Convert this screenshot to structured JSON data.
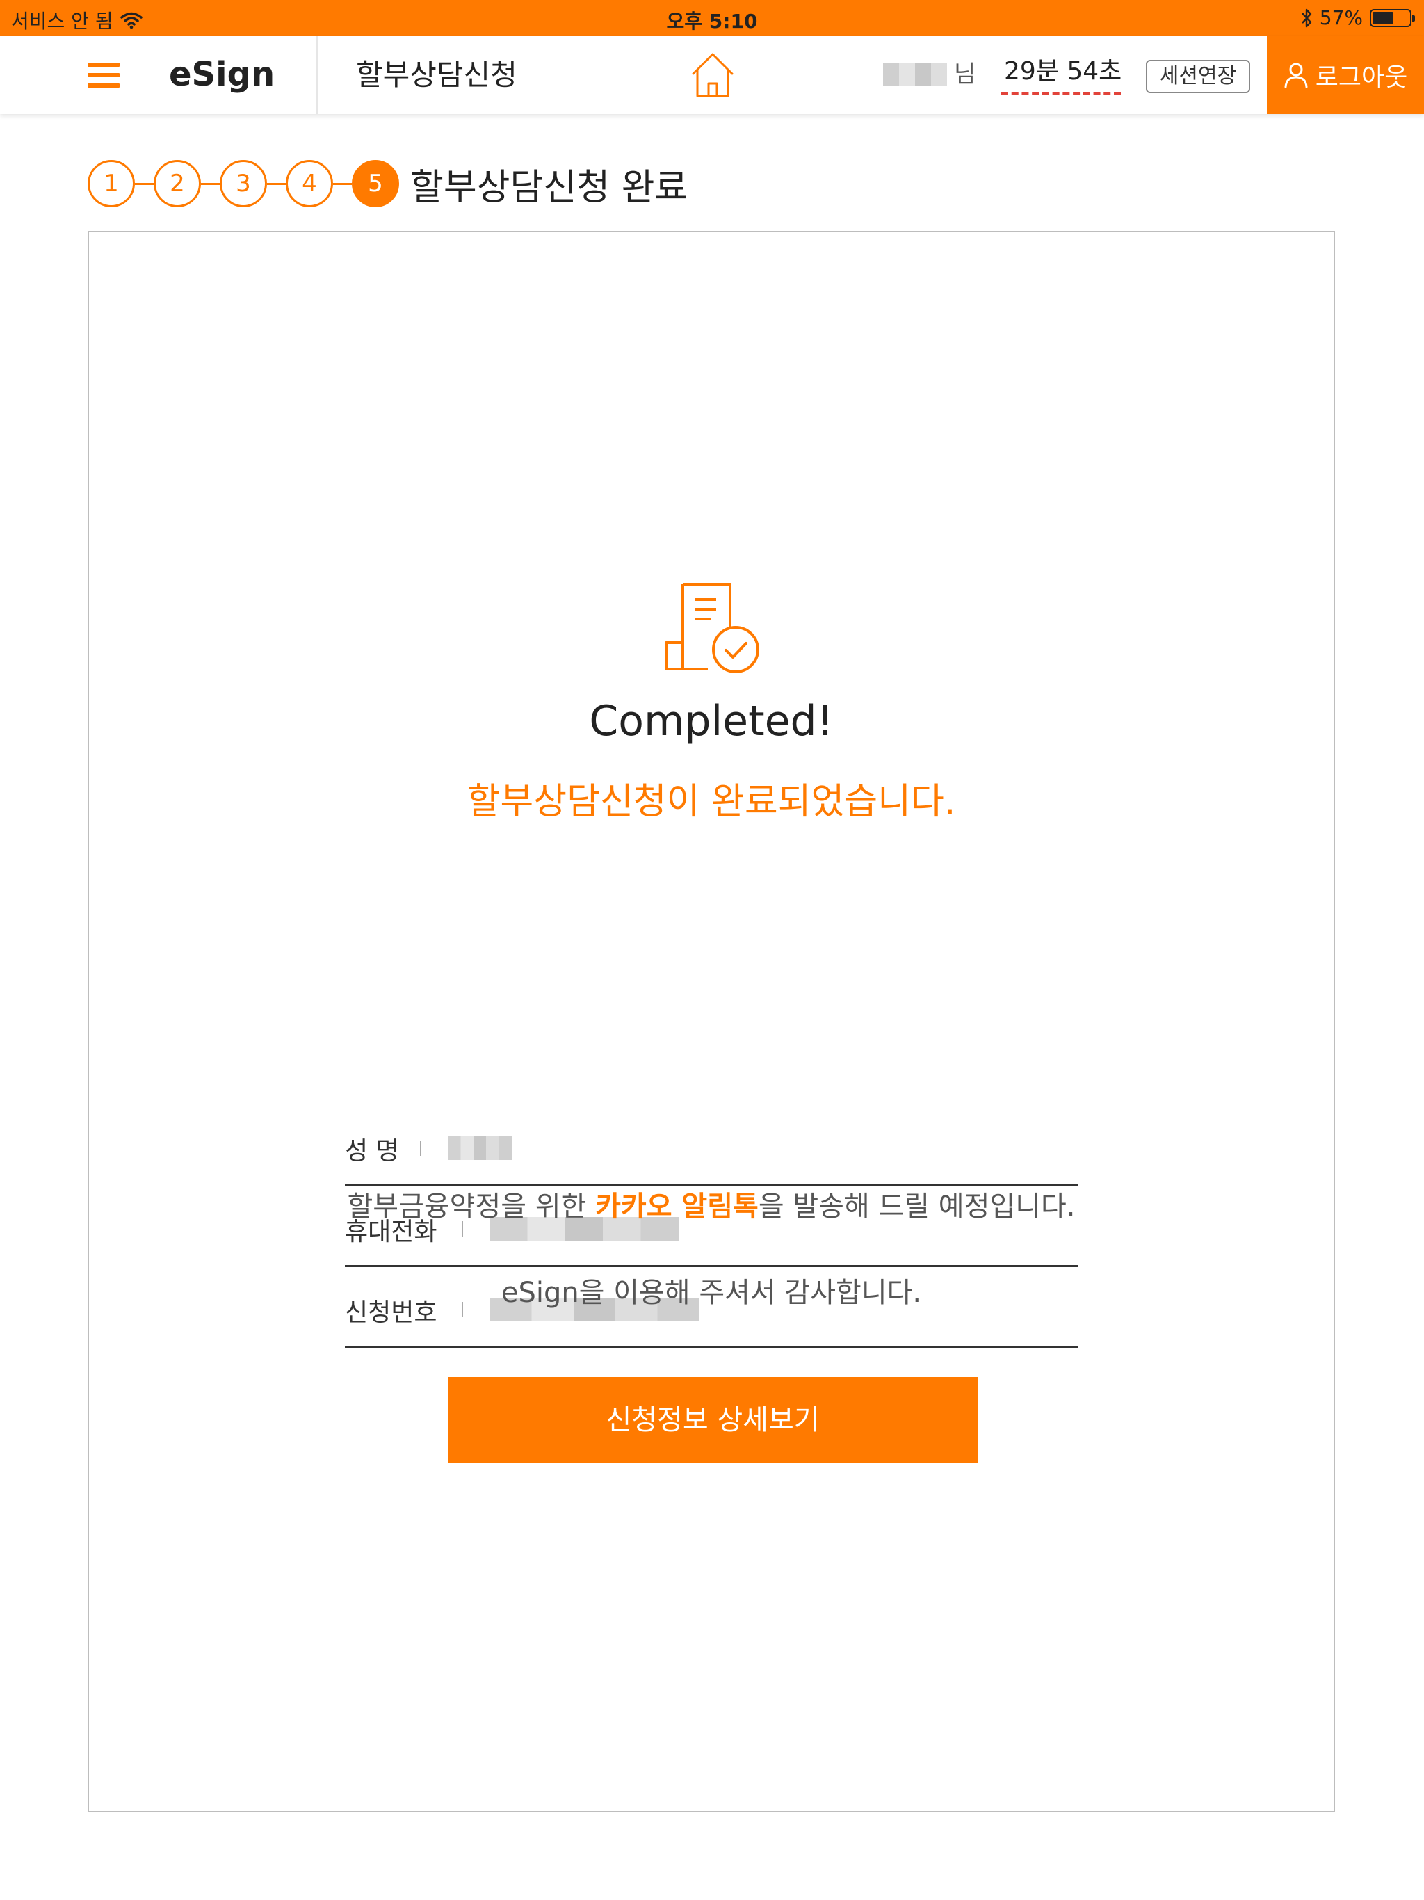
{
  "status_bar": {
    "carrier": "서비스 안 됨",
    "time": "오후 5:10",
    "battery_text": "57%",
    "battery_level": 0.57,
    "icons": [
      "wifi-icon",
      "bluetooth-icon",
      "battery-icon"
    ]
  },
  "header": {
    "brand": "eSign",
    "title": "할부상담신청",
    "user_suffix": "님",
    "timer": "29분 54초",
    "session_extend_label": "세션연장",
    "logout_label": "로그아웃",
    "icons": [
      "menu-icon",
      "home-icon",
      "user-icon"
    ]
  },
  "steps": {
    "items": [
      "1",
      "2",
      "3",
      "4",
      "5"
    ],
    "active_index": 4,
    "title": "할부상담신청 완료"
  },
  "result": {
    "icon": "document-check-icon",
    "heading": "Completed!",
    "subheading": "할부상담신청이 완료되었습니다.",
    "fields": [
      {
        "label": "성 명",
        "value": ""
      },
      {
        "label": "휴대전화",
        "value": ""
      },
      {
        "label": "신청번호",
        "value": ""
      }
    ],
    "notice_prefix": "할부금융약정을 위한 ",
    "notice_highlight": "카카오 알림톡",
    "notice_suffix": "을 발송해 드릴 예정입니다.",
    "thanks": "eSign을 이용해 주셔서 감사합니다.",
    "detail_button_label": "신청정보 상세보기"
  },
  "colors": {
    "accent": "#ff7a00",
    "timer_underline": "#e2433a",
    "text": "#333333"
  }
}
